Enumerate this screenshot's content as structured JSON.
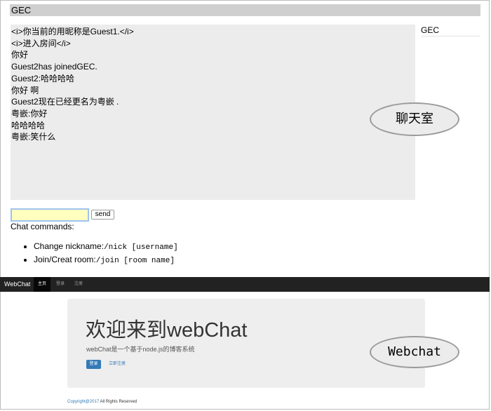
{
  "chat": {
    "room_name": "GEC",
    "side_room": "GEC",
    "messages": [
      "<i>你当前的用昵称是Guest1.</i>",
      "<i>进入房间</i>",
      "你好",
      "Guest2has joinedGEC.",
      "Guest2:哈哈哈哈",
      "你好 啊",
      "Guest2现在已经更名为粤嵌 .",
      "粤嵌:你好",
      "哈哈哈哈",
      "粤嵌:笑什么"
    ],
    "input_value": "",
    "send_label": "send",
    "commands_title": "Chat commands:",
    "commands": [
      {
        "label": "Change nickname:",
        "code": "/nick [username]"
      },
      {
        "label": "Join/Creat room:",
        "code": "/join [room name]"
      }
    ]
  },
  "annotations": {
    "chat_room": "聊天室",
    "webchat": "Webchat"
  },
  "webchat": {
    "navbar": {
      "brand": "WebChat",
      "items": [
        "主页",
        "登录",
        "注册"
      ]
    },
    "jumbotron": {
      "heading": "欢迎来到webChat",
      "subtitle": "webChat是一个基于node.js的博客系统",
      "login_button": "登录",
      "register_link": "立即注册"
    },
    "footer": {
      "copyright": "Copyright@2017",
      "rights": " All Rights Reserved"
    }
  },
  "colors": {
    "navbar": "#222222",
    "link": "#337ab7",
    "input_bg": "#ffffc0"
  }
}
